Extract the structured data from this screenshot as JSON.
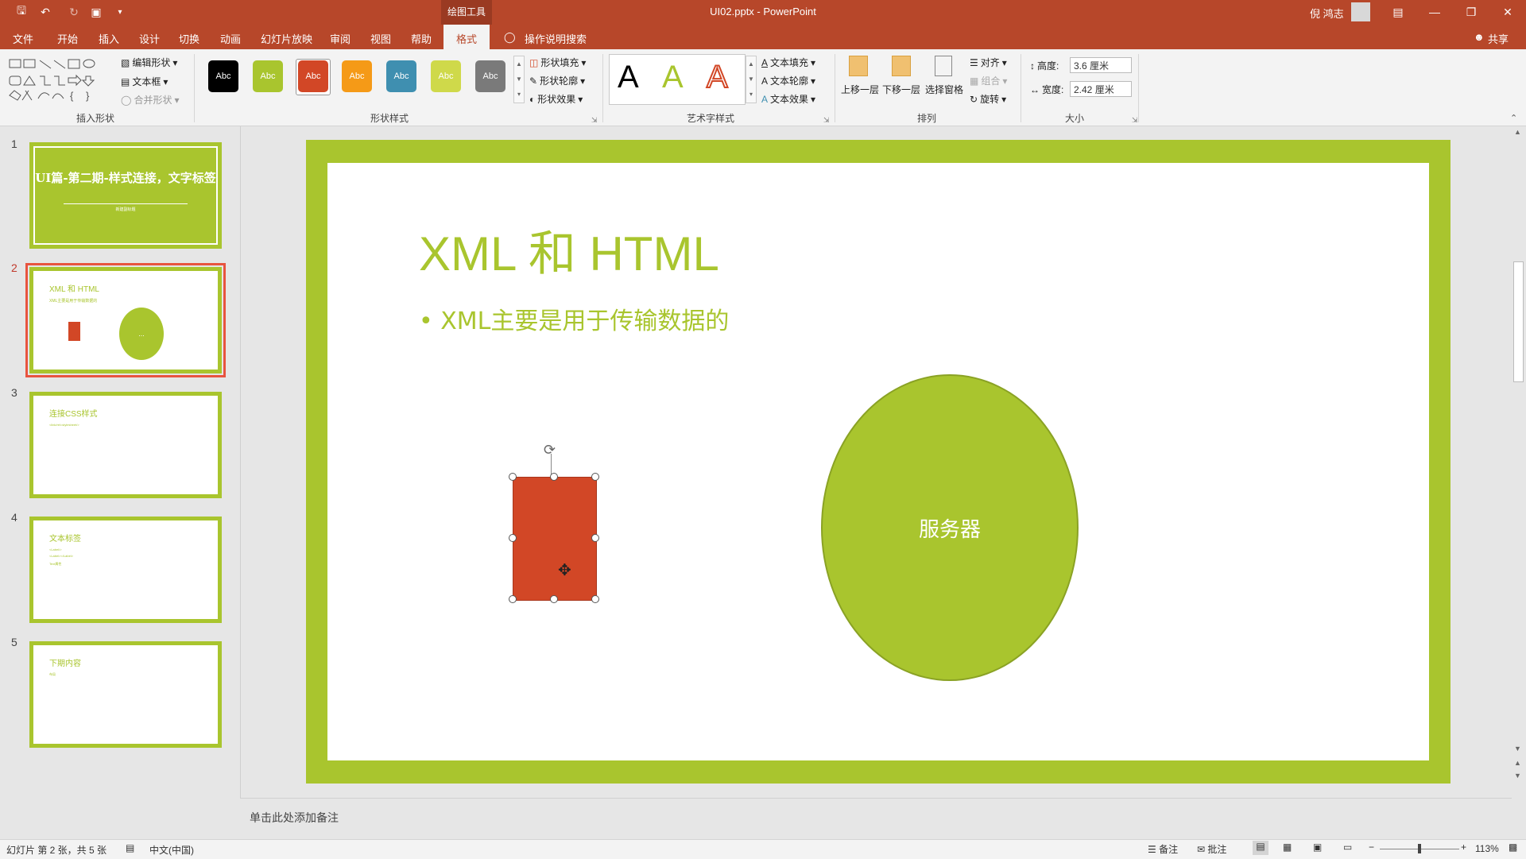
{
  "window": {
    "doc_title": "UI02.pptx  -  PowerPoint",
    "context_group": "绘图工具",
    "user_name": "倪 鸿志",
    "share": "共享"
  },
  "tabs": [
    "文件",
    "开始",
    "插入",
    "设计",
    "切换",
    "动画",
    "幻灯片放映",
    "审阅",
    "视图",
    "帮助"
  ],
  "active_tab": "格式",
  "tell_me": "操作说明搜索",
  "ribbon": {
    "insert_shapes": {
      "label": "插入形状",
      "edit_shape": "编辑形状",
      "text_box": "文本框",
      "merge_shapes": "合并形状"
    },
    "shape_styles": {
      "label": "形状样式",
      "swatch_text": "Abc",
      "fill": "形状填充",
      "outline": "形状轮廓",
      "effects": "形状效果",
      "swatches": [
        "#000000",
        "#a9c52e",
        "#d24726",
        "#f59a17",
        "#3f8fb0",
        "#cfd94a",
        "#7a7a7a"
      ]
    },
    "wordart": {
      "label": "艺术字样式",
      "letter": "A",
      "text_fill": "文本填充",
      "text_outline": "文本轮廓",
      "text_effects": "文本效果"
    },
    "arrange": {
      "label": "排列",
      "bring_forward": "上移一层",
      "send_backward": "下移一层",
      "selection_pane": "选择窗格",
      "align": "对齐",
      "group": "组合",
      "rotate": "旋转"
    },
    "size": {
      "label": "大小",
      "height_label": "高度:",
      "height_value": "3.6 厘米",
      "width_label": "宽度:",
      "width_value": "2.42 厘米"
    }
  },
  "thumbnails": [
    {
      "num": "1",
      "title": "UI篇-第二期-样式连接，文字标签",
      "subtitle": "新建副标题"
    },
    {
      "num": "2",
      "title": "XML 和 HTML",
      "bullet": "XML主要是用于传输数据的",
      "ellipse_text": "..."
    },
    {
      "num": "3",
      "title": "连接CSS样式",
      "bullet": "<link/rel=stylesheet/>"
    },
    {
      "num": "4",
      "title": "文本标签",
      "bullets": [
        "<Label/>",
        "<Label></Label>",
        "Text属性"
      ]
    },
    {
      "num": "5",
      "title": "下期内容",
      "bullet": "布局"
    }
  ],
  "slide": {
    "title": "XML 和 HTML",
    "bullet": "XML主要是用于传输数据的",
    "ellipse_text": "服务器",
    "accent": "#a9c52e",
    "rect_color": "#d24726"
  },
  "notes_placeholder": "单击此处添加备注",
  "status": {
    "slide_info": "幻灯片 第 2 张，共 5 张",
    "language": "中文(中国)",
    "notes": "备注",
    "comments": "批注",
    "zoom": "113%"
  }
}
